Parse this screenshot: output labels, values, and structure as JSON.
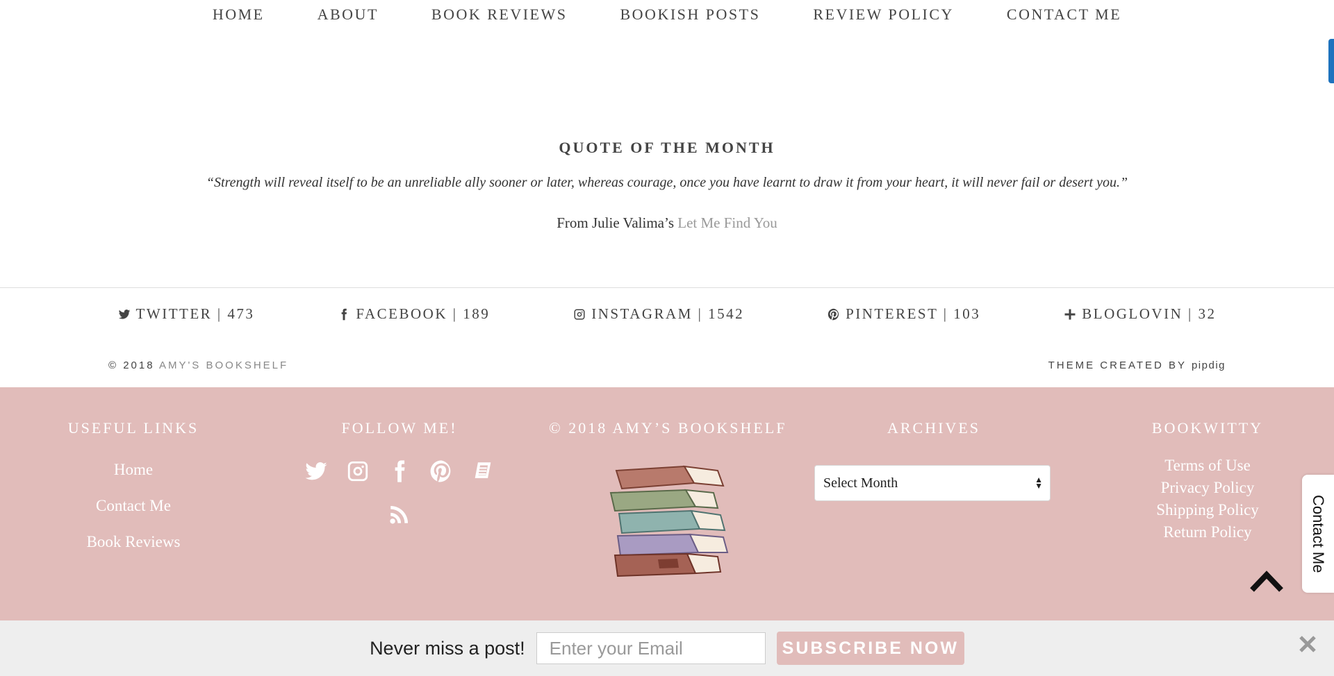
{
  "nav": {
    "items": [
      "HOME",
      "ABOUT",
      "BOOK REVIEWS",
      "BOOKISH POSTS",
      "REVIEW POLICY",
      "CONTACT ME"
    ]
  },
  "quote": {
    "heading": "QUOTE OF THE MONTH",
    "text": "“Strength will reveal itself to be an unreliable ally sooner or later, whereas courage, once you have learnt to draw it from your heart, it will never fail or desert you.”",
    "source_prefix": "From Julie Valima’s",
    "source_title": "Let Me Find You"
  },
  "social": [
    {
      "icon": "twitter-icon",
      "label": "TWITTER | 473"
    },
    {
      "icon": "facebook-icon",
      "label": "FACEBOOK | 189"
    },
    {
      "icon": "instagram-icon",
      "label": "INSTAGRAM | 1542"
    },
    {
      "icon": "pinterest-icon",
      "label": "PINTEREST | 103"
    },
    {
      "icon": "plus-icon",
      "label": "BLOGLOVIN | 32"
    }
  ],
  "copyright": {
    "prefix": "© 2018",
    "site": "AMY'S BOOKSHELF",
    "theme_prefix": "THEME CREATED BY",
    "theme_author": "pipdig"
  },
  "footer": {
    "useful_links": {
      "title": "USEFUL LINKS",
      "links": [
        "Home",
        "Contact Me",
        "Book Reviews"
      ]
    },
    "follow": {
      "title": "FOLLOW ME!",
      "icons": [
        "twitter-icon",
        "instagram-icon",
        "facebook-icon",
        "pinterest-icon",
        "bloglovin-icon",
        "rss-icon"
      ]
    },
    "copyright_title": "© 2018 AMY’S BOOKSHELF",
    "archives": {
      "title": "ARCHIVES",
      "selected": "Select Month"
    },
    "bookwitty": {
      "title": "BOOKWITTY",
      "links": [
        "Terms of Use",
        "Privacy Policy",
        "Shipping Policy",
        "Return Policy"
      ]
    }
  },
  "contact_tab": "Contact Me",
  "subscribe": {
    "prompt": "Never miss a post!",
    "placeholder": "Enter your Email",
    "button": "SUBSCRIBE NOW"
  },
  "colors": {
    "footer_bg": "#e1bcba",
    "accent_blue": "#1e73be",
    "subscribe_bg": "#eeeeee"
  }
}
